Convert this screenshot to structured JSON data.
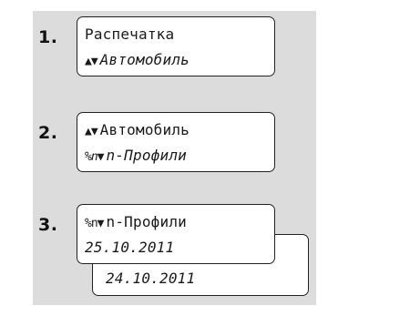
{
  "steps": [
    {
      "number": "1.",
      "line1": {
        "symbol": "▲▼",
        "text": "Распечатка"
      },
      "line2": {
        "symbol": "▲▼",
        "text": "Автомобиль"
      }
    },
    {
      "number": "2.",
      "line1": {
        "symbol": "▲▼",
        "text": "Автомобиль"
      },
      "line2": {
        "symbol": "%n▼",
        "text": "n-Профили"
      }
    },
    {
      "number": "3.",
      "line1": {
        "symbol": "%n▼",
        "text": "n-Профили"
      },
      "line2": {
        "text": "25.10.2011"
      },
      "line3": {
        "text": "24.10.2011"
      }
    }
  ]
}
